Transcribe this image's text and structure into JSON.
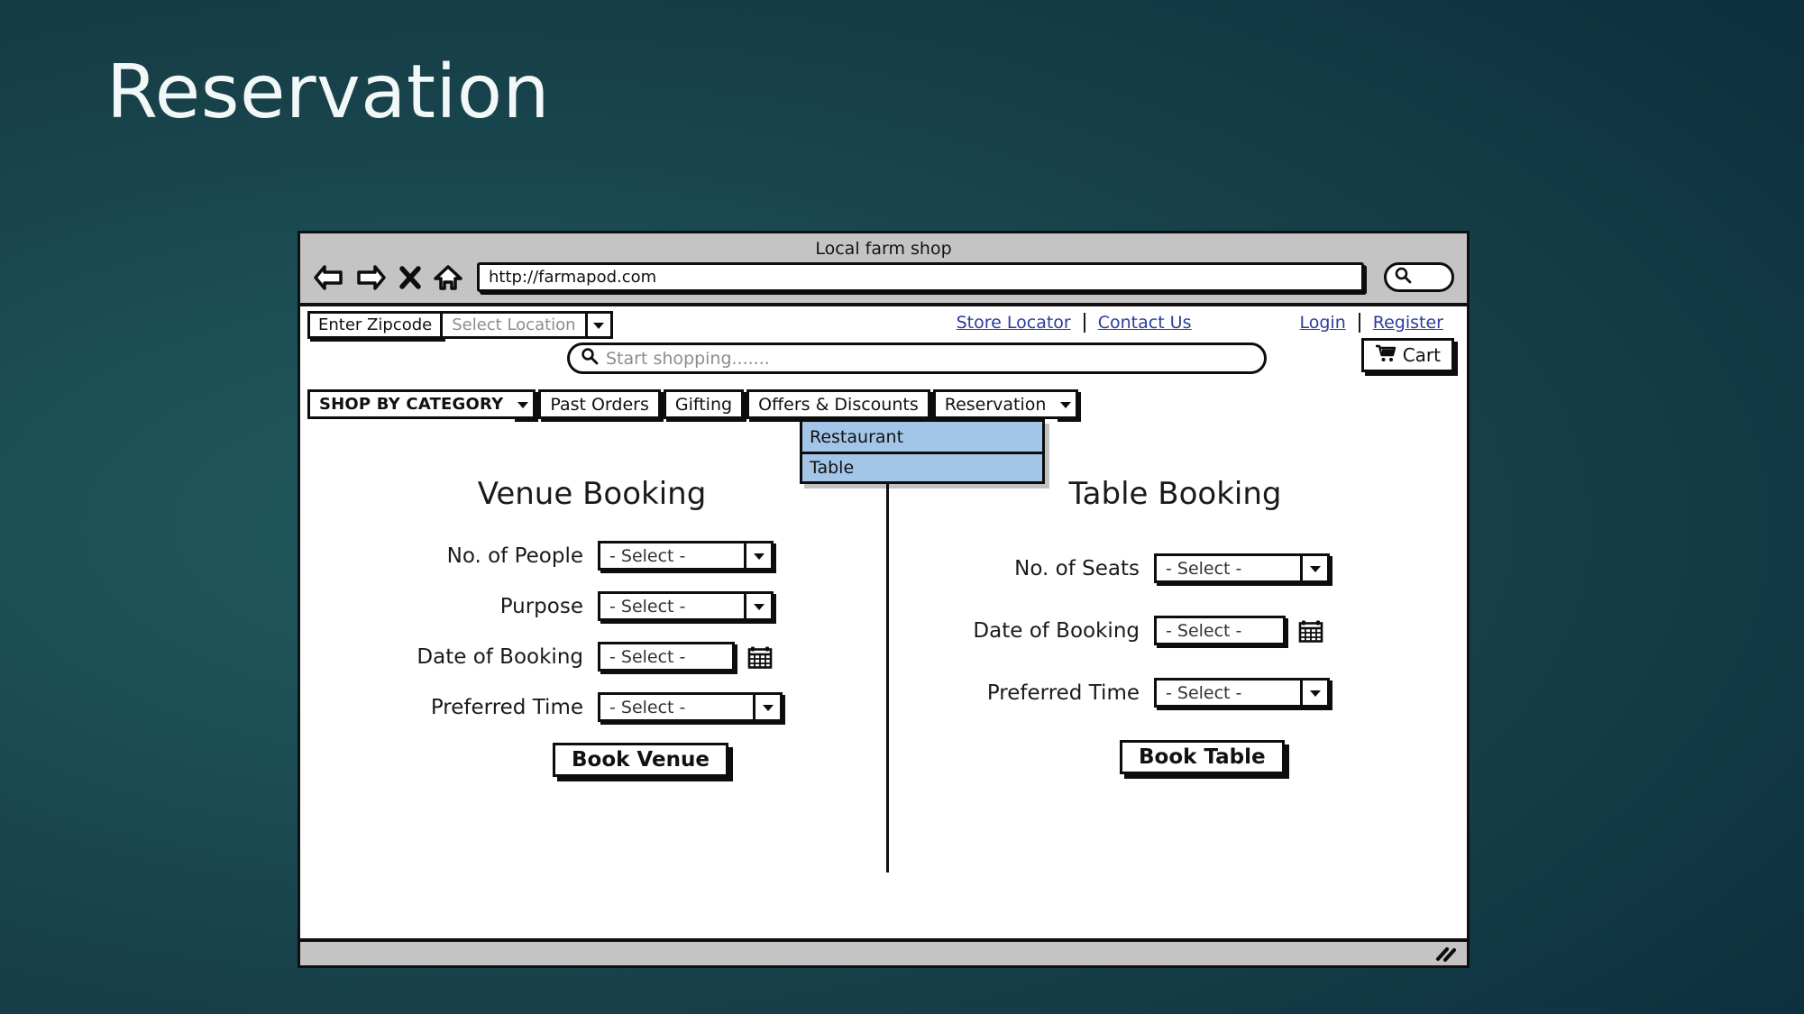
{
  "slide": {
    "title": "Reservation",
    "background_color_outer": "#0e2f3d",
    "background_color_inner": "#20595c",
    "title_color": "#f2f7f7"
  },
  "browser": {
    "window_title": "Local farm shop",
    "url": "http://farmapod.com",
    "nav_icons": [
      "back-arrow-icon",
      "forward-arrow-icon",
      "close-x-icon",
      "home-icon"
    ],
    "search_icon": "magnifier-icon"
  },
  "utility": {
    "zipcode_label": "Enter Zipcode",
    "location_placeholder": "Select Location",
    "location_arrow": "chevron-down-icon",
    "links": [
      {
        "label": "Store Locator"
      },
      {
        "label": "Contact Us"
      },
      {
        "label": "Login"
      },
      {
        "label": "Register"
      }
    ],
    "link_color": "#2b3d9e"
  },
  "search": {
    "placeholder": "Start shopping.......",
    "icon": "magnifier-icon"
  },
  "cart": {
    "label": "Cart",
    "icon": "shopping-cart-icon"
  },
  "nav": {
    "tabs": [
      {
        "label": "SHOP BY CATEGORY",
        "has_arrow": true
      },
      {
        "label": "Past Orders",
        "has_arrow": false
      },
      {
        "label": "Gifting",
        "has_arrow": false
      },
      {
        "label": "Offers & Discounts",
        "has_arrow": false
      },
      {
        "label": "Reservation",
        "has_arrow": true
      }
    ],
    "dropdown": {
      "open": true,
      "highlight_color": "#a3c6e8",
      "items": [
        {
          "label": "Restaurant"
        },
        {
          "label": "Table"
        }
      ]
    }
  },
  "venue_booking": {
    "title": "Venue Booking",
    "fields": [
      {
        "label": "No. of People",
        "value": "- Select -",
        "type": "select"
      },
      {
        "label": "Purpose",
        "value": "- Select -",
        "type": "select"
      },
      {
        "label": "Date of Booking",
        "value": "- Select -",
        "type": "date"
      },
      {
        "label": "Preferred Time",
        "value": "- Select -",
        "type": "select"
      }
    ],
    "submit_label": "Book Venue"
  },
  "table_booking": {
    "title": "Table Booking",
    "fields": [
      {
        "label": "No. of Seats",
        "value": "- Select -",
        "type": "select"
      },
      {
        "label": "Date of Booking",
        "value": "- Select -",
        "type": "date"
      },
      {
        "label": "Preferred Time",
        "value": "- Select -",
        "type": "select"
      }
    ],
    "submit_label": "Book Table"
  },
  "statusbar": {
    "resize_grip_icon": "resize-grip-icon"
  }
}
